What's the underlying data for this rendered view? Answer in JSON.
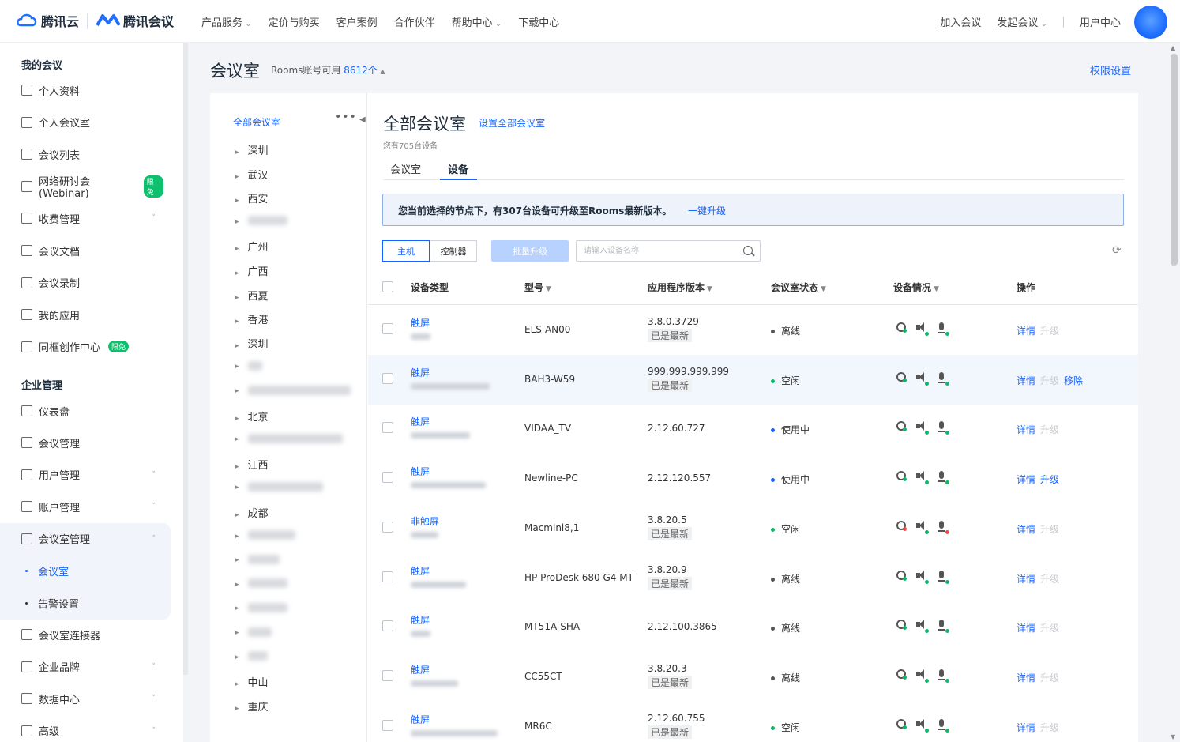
{
  "header": {
    "brand1": "腾讯云",
    "brand2": "腾讯会议",
    "nav": [
      {
        "label": "产品服务",
        "dropdown": true
      },
      {
        "label": "定价与购买",
        "dropdown": false
      },
      {
        "label": "客户案例",
        "dropdown": false
      },
      {
        "label": "合作伙伴",
        "dropdown": false
      },
      {
        "label": "帮助中心",
        "dropdown": true
      },
      {
        "label": "下载中心",
        "dropdown": false
      }
    ],
    "right": {
      "join": "加入会议",
      "start": "发起会议",
      "user_center": "用户中心"
    }
  },
  "sidebar": {
    "group1": "我的会议",
    "my_items": [
      {
        "label": "个人资料",
        "icon": "user-icon"
      },
      {
        "label": "个人会议室",
        "icon": "room-icon"
      },
      {
        "label": "会议列表",
        "icon": "list-icon"
      },
      {
        "label": "网络研讨会(Webinar)",
        "icon": "webinar-icon",
        "tag": "限免"
      },
      {
        "label": "收费管理",
        "icon": "billing-icon",
        "expand": true
      },
      {
        "label": "会议文档",
        "icon": "document-icon"
      },
      {
        "label": "会议录制",
        "icon": "record-icon"
      },
      {
        "label": "我的应用",
        "icon": "apps-icon"
      },
      {
        "label": "同框创作中心",
        "icon": "create-icon",
        "tag": "限免"
      }
    ],
    "group2": "企业管理",
    "ent_items": [
      {
        "label": "仪表盘",
        "icon": "dashboard-icon"
      },
      {
        "label": "会议管理",
        "icon": "grid-icon"
      },
      {
        "label": "用户管理",
        "icon": "users-icon",
        "expand": true
      },
      {
        "label": "账户管理",
        "icon": "wallet-icon",
        "expand": true
      },
      {
        "label": "会议室管理",
        "icon": "room-manage-icon",
        "expand": true,
        "open": true
      }
    ],
    "sub_items": [
      {
        "label": "会议室",
        "active": true
      },
      {
        "label": "告警设置",
        "active": false
      }
    ],
    "ent_items2": [
      {
        "label": "会议室连接器",
        "icon": "connector-icon"
      },
      {
        "label": "企业品牌",
        "icon": "brand-icon",
        "expand": true
      },
      {
        "label": "数据中心",
        "icon": "data-icon",
        "expand": true
      },
      {
        "label": "高级",
        "icon": "advanced-icon",
        "expand": true
      }
    ]
  },
  "page": {
    "title": "会议室",
    "rooms_label": "Rooms账号可用",
    "rooms_count": "8612个",
    "perm_link": "权限设置"
  },
  "tree": {
    "root": "全部会议室",
    "nodes": [
      "深圳",
      "武汉",
      "西安",
      "",
      "广州",
      "广西",
      "西夏",
      "香港",
      "深圳",
      "",
      "",
      "北京",
      "",
      "江西",
      "",
      "成都",
      "",
      "",
      "",
      "",
      "",
      "",
      "中山",
      "重庆"
    ]
  },
  "panel": {
    "title": "全部会议室",
    "setting_link": "设置全部会议室",
    "subtitle": "您有705台设备",
    "tabs": [
      "会议室",
      "设备"
    ],
    "active_tab": "设备",
    "banner_text": "您当前选择的节点下，有307台设备可升级至Rooms最新版本。",
    "banner_link": "一键升级",
    "seg": [
      "主机",
      "控制器"
    ],
    "batch_upgrade": "批量升级",
    "search_placeholder": "请输入设备名称"
  },
  "table": {
    "columns": [
      "设备类型",
      "型号",
      "应用程序版本",
      "会议室状态",
      "设备情况",
      "操作"
    ],
    "rows": [
      {
        "type": "触屏",
        "model": "ELS-AN00",
        "version": "3.8.0.3729",
        "latest": "已是最新",
        "status": "离线",
        "status_color": "#555555",
        "ops": [
          "详情",
          "升级"
        ],
        "upgrade_enabled": false,
        "highlight": false,
        "mic_bad": false,
        "cam_bad": false
      },
      {
        "type": "触屏",
        "model": "BAH3-W59",
        "version": "999.999.999.999",
        "latest": "已是最新",
        "status": "空闲",
        "status_color": "#10b76a",
        "ops": [
          "详情",
          "升级",
          "移除"
        ],
        "upgrade_enabled": false,
        "highlight": true,
        "mic_bad": false,
        "cam_bad": false
      },
      {
        "type": "触屏",
        "model": "VIDAA_TV",
        "version": "2.12.60.727",
        "latest": "",
        "status": "使用中",
        "status_color": "#1663ff",
        "ops": [
          "详情",
          "升级"
        ],
        "upgrade_enabled": false,
        "highlight": false,
        "mic_bad": false,
        "cam_bad": false
      },
      {
        "type": "触屏",
        "model": "Newline-PC",
        "version": "2.12.120.557",
        "latest": "",
        "status": "使用中",
        "status_color": "#1663ff",
        "ops": [
          "详情",
          "升级"
        ],
        "upgrade_enabled": true,
        "highlight": false,
        "mic_bad": false,
        "cam_bad": false
      },
      {
        "type": "非触屏",
        "model": "Macmini8,1",
        "version": "3.8.20.5",
        "latest": "已是最新",
        "status": "空闲",
        "status_color": "#10b76a",
        "ops": [
          "详情",
          "升级"
        ],
        "upgrade_enabled": false,
        "highlight": false,
        "mic_bad": true,
        "cam_bad": true
      },
      {
        "type": "触屏",
        "model": "HP ProDesk 680 G4 MT",
        "version": "3.8.20.9",
        "latest": "已是最新",
        "status": "离线",
        "status_color": "#555555",
        "ops": [
          "详情",
          "升级"
        ],
        "upgrade_enabled": false,
        "highlight": false,
        "mic_bad": false,
        "cam_bad": false
      },
      {
        "type": "触屏",
        "model": "MT51A-SHA",
        "version": "2.12.100.3865",
        "latest": "",
        "status": "离线",
        "status_color": "#555555",
        "ops": [
          "详情",
          "升级"
        ],
        "upgrade_enabled": false,
        "highlight": false,
        "mic_bad": false,
        "cam_bad": false
      },
      {
        "type": "触屏",
        "model": "CC55CT",
        "version": "3.8.20.3",
        "latest": "已是最新",
        "status": "离线",
        "status_color": "#555555",
        "ops": [
          "详情",
          "升级"
        ],
        "upgrade_enabled": false,
        "highlight": false,
        "mic_bad": false,
        "cam_bad": false
      },
      {
        "type": "触屏",
        "model": "MR6C",
        "version": "2.12.60.755",
        "latest": "已是最新",
        "status": "空闲",
        "status_color": "#10b76a",
        "ops": [
          "详情",
          "升级"
        ],
        "upgrade_enabled": false,
        "highlight": false,
        "mic_bad": false,
        "cam_bad": false
      }
    ]
  },
  "colors": {
    "accent": "#1663ff",
    "online": "#10b76a",
    "offline": "#555555",
    "error": "#f04646"
  }
}
